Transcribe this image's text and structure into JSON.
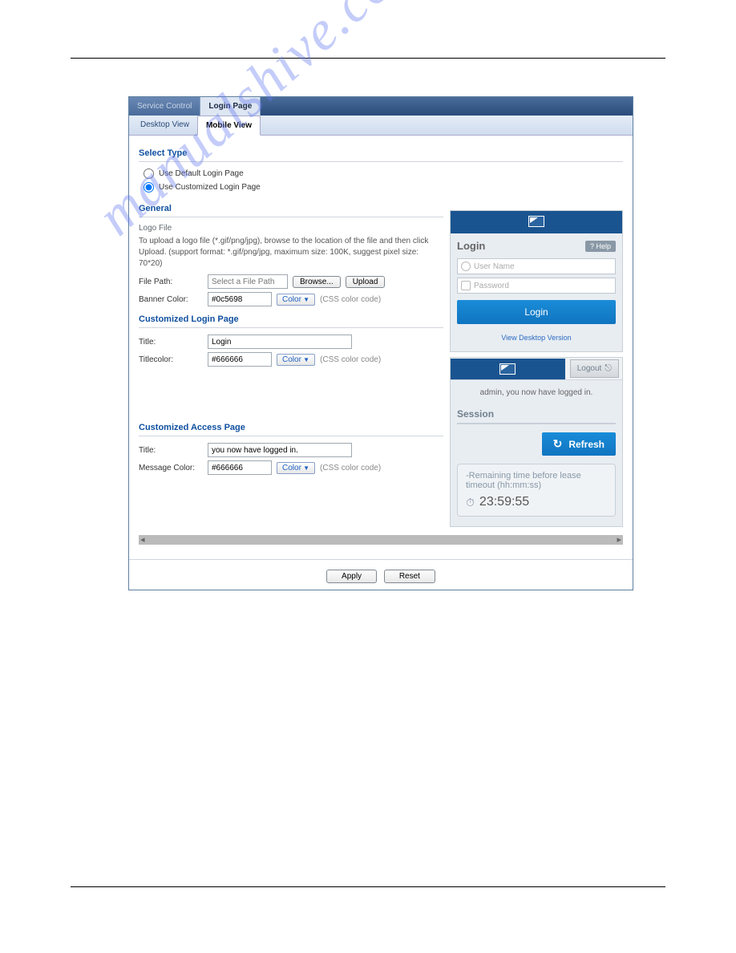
{
  "tabs_top": {
    "service": "Service Control",
    "login": "Login Page"
  },
  "tabs_sub": {
    "desktop": "Desktop View",
    "mobile": "Mobile View"
  },
  "select_type": {
    "heading": "Select Type",
    "opt_default": "Use Default Login Page",
    "opt_custom": "Use Customized Login Page"
  },
  "general": {
    "heading": "General",
    "logo_file": "Logo File",
    "desc": "To upload a logo file (*.gif/png/jpg), browse to the location of the file and then click Upload. (support format: *.gif/png/jpg, maximum size: 100K, suggest pixel size: 70*20)",
    "file_path_lbl": "File Path:",
    "file_path_ph": "Select a File Path",
    "browse": "Browse...",
    "upload": "Upload",
    "banner_color_lbl": "Banner Color:",
    "banner_color_val": "#0c5698",
    "color_btn": "Color",
    "css_hint": "(CSS color code)"
  },
  "clp": {
    "heading": "Customized Login Page",
    "title_lbl": "Title:",
    "title_val": "Login",
    "titlecolor_lbl": "Titlecolor:",
    "titlecolor_val": "#666666"
  },
  "cap": {
    "heading": "Customized Access Page",
    "title_lbl": "Title:",
    "title_val": "you now have logged in.",
    "msg_lbl": "Message Color:",
    "msg_val": "#666666"
  },
  "preview_login": {
    "title": "Login",
    "help": "? Help",
    "username_ph": "User Name",
    "password_ph": "Password",
    "login_btn": "Login",
    "view_desktop": "View Desktop Version"
  },
  "preview_access": {
    "logout": "Logout",
    "msg": "admin, you now have logged in.",
    "session": "Session",
    "refresh": "Refresh",
    "remain": "-Remaining time before lease timeout (hh:mm:ss)",
    "time": "23:59:55"
  },
  "footer": {
    "apply": "Apply",
    "reset": "Reset"
  },
  "watermark": "manualshive.com"
}
